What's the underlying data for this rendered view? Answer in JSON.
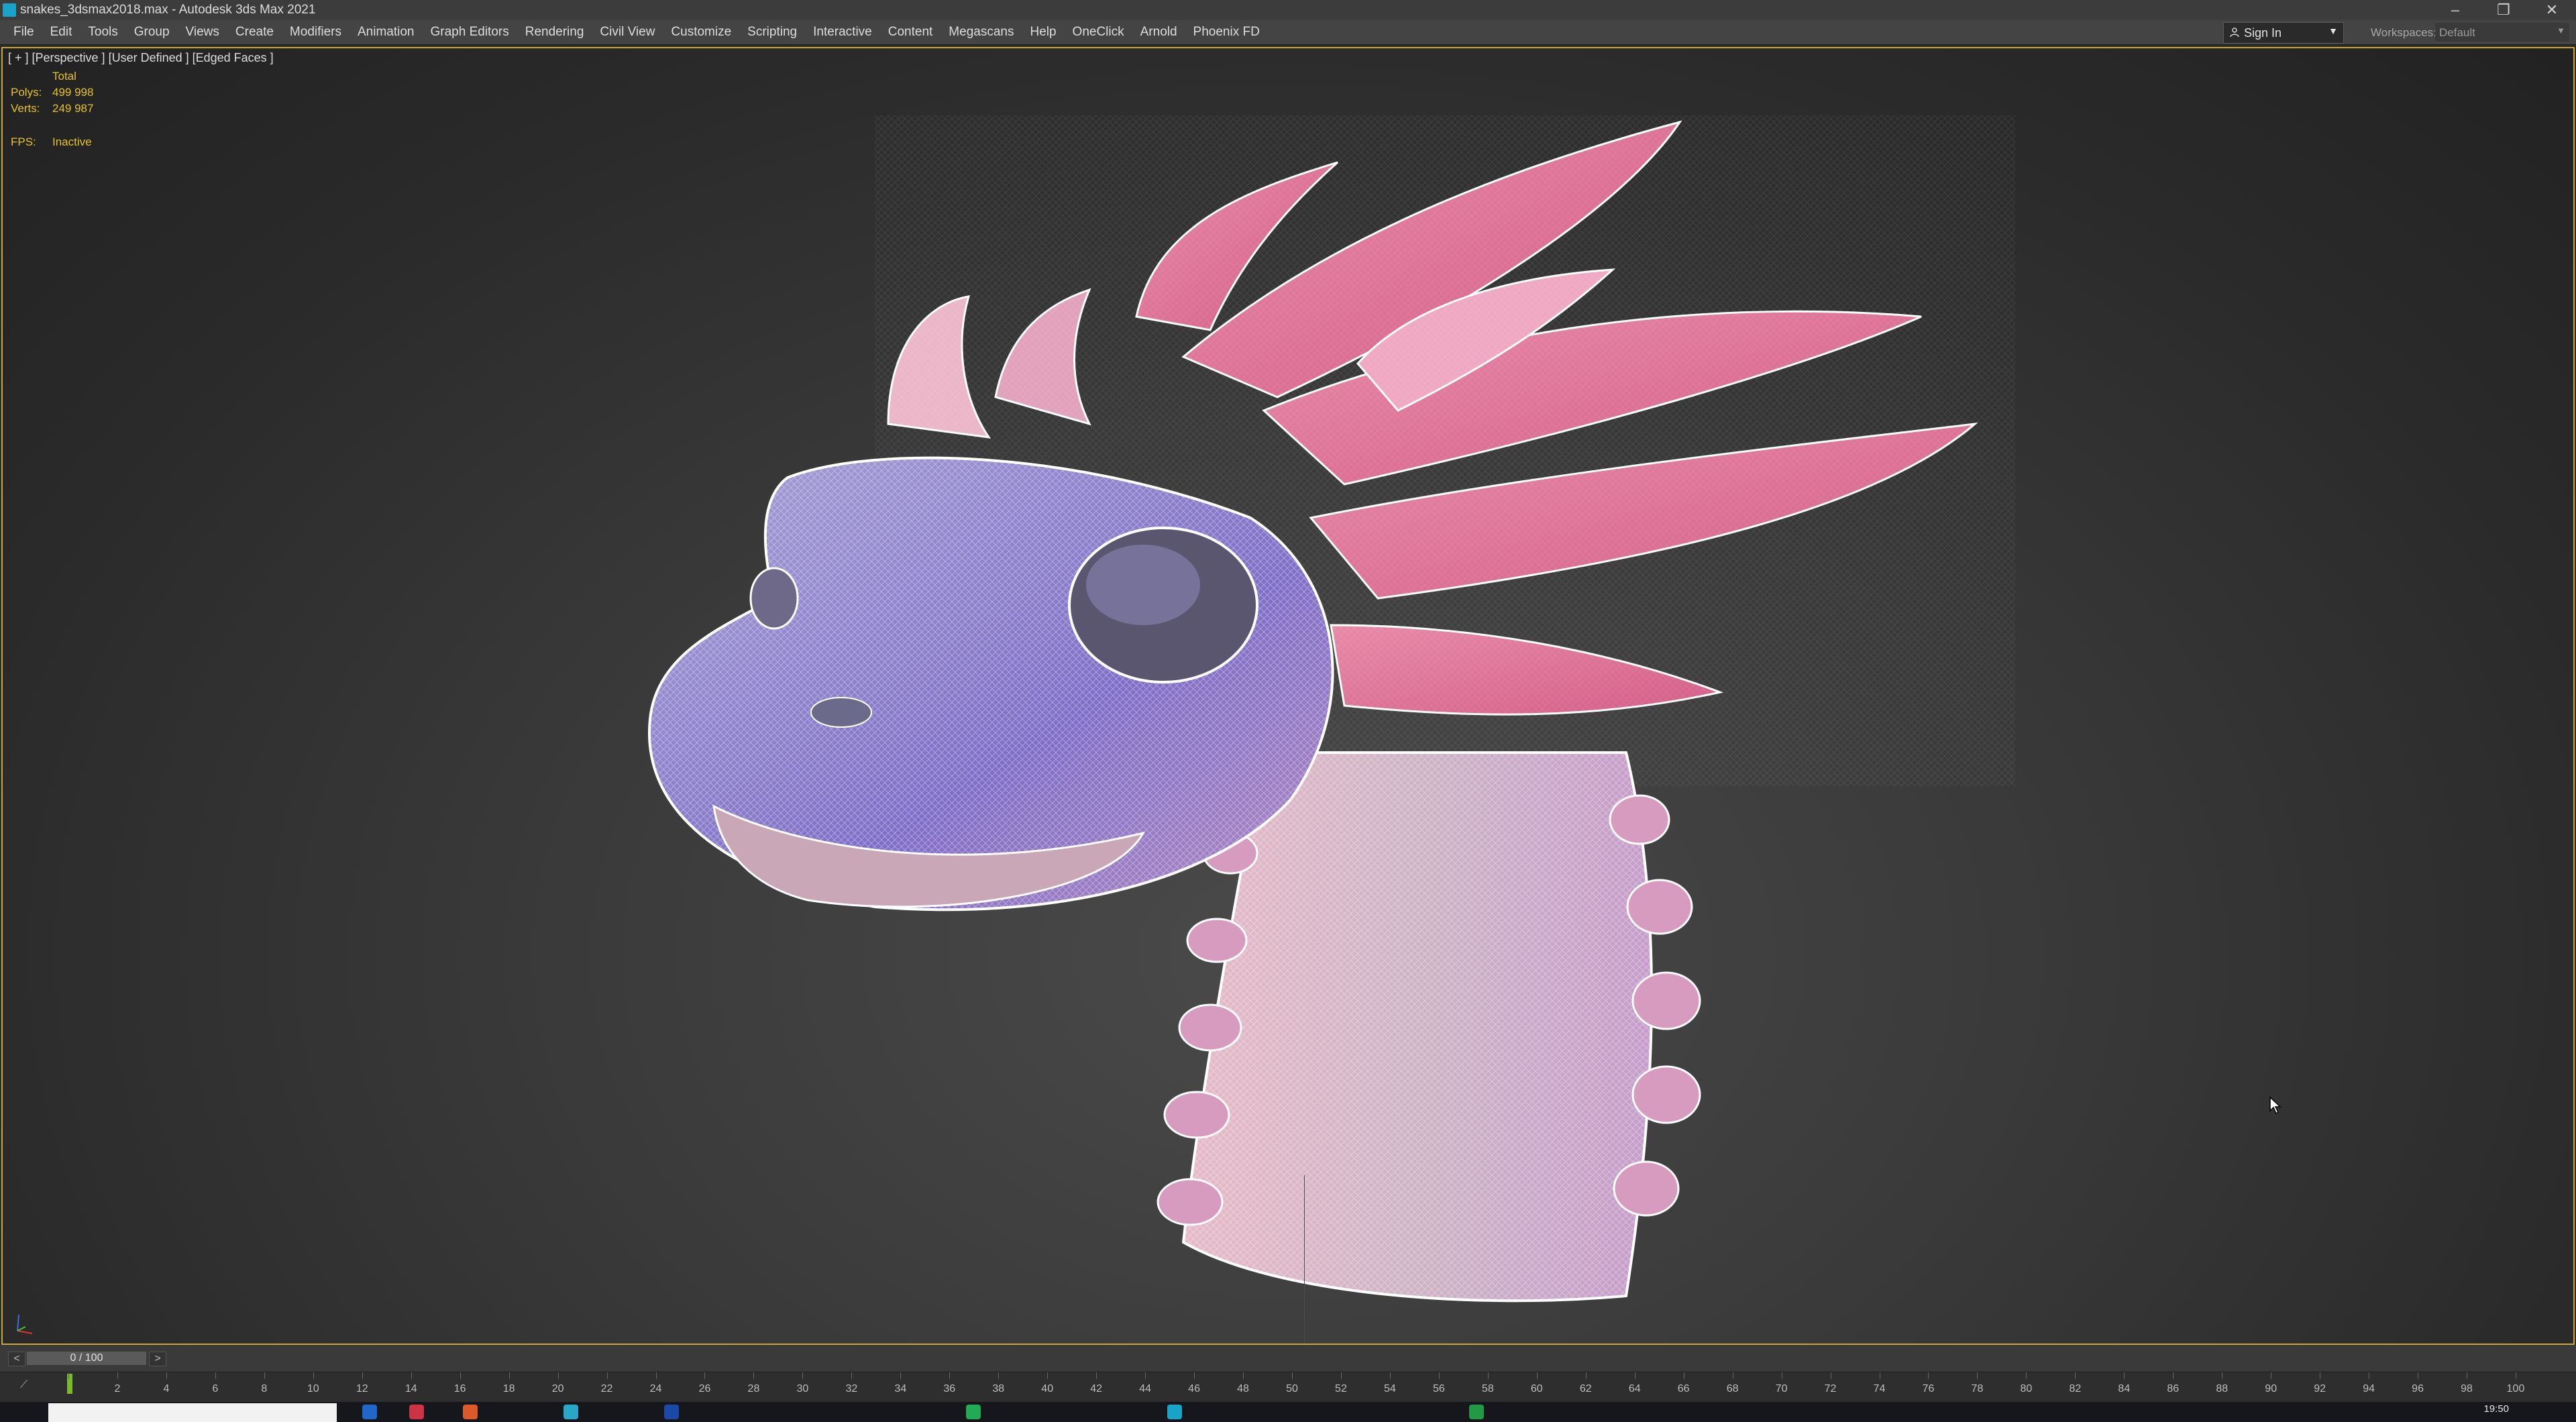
{
  "window": {
    "title": "snakes_3dsmax2018.max - Autodesk 3ds Max 2021",
    "controls": {
      "minimize": "–",
      "restore": "❐",
      "close": "✕"
    }
  },
  "menubar": {
    "items": [
      "File",
      "Edit",
      "Tools",
      "Group",
      "Views",
      "Create",
      "Modifiers",
      "Animation",
      "Graph Editors",
      "Rendering",
      "Civil View",
      "Customize",
      "Scripting",
      "Interactive",
      "Content",
      "Megascans",
      "Help",
      "OneClick",
      "Arnold",
      "Phoenix FD"
    ],
    "sign_in": "Sign In",
    "workspaces_label": "Workspaces:",
    "workspaces_value": "Default"
  },
  "viewport": {
    "label": "[ + ] [Perspective ] [User Defined ] [Edged Faces ]",
    "stats_header": "Total",
    "polys_label": "Polys:",
    "polys_value": "499 998",
    "verts_label": "Verts:",
    "verts_value": "249 987",
    "fps_label": "FPS:",
    "fps_value": "Inactive"
  },
  "timeline": {
    "prev": "<",
    "next": ">",
    "slider_text": "0 / 100",
    "current_frame": 0,
    "total_frames": 100,
    "ticks": [
      "0",
      "2",
      "4",
      "6",
      "8",
      "10",
      "12",
      "14",
      "16",
      "18",
      "20",
      "22",
      "24",
      "26",
      "28",
      "30",
      "32",
      "34",
      "36",
      "38",
      "40",
      "42",
      "44",
      "46",
      "48",
      "50",
      "52",
      "54",
      "56",
      "58",
      "60",
      "62",
      "64",
      "66",
      "68",
      "70",
      "72",
      "74",
      "76",
      "78",
      "80",
      "82",
      "84",
      "86",
      "88",
      "90",
      "92",
      "94",
      "96",
      "98",
      "100"
    ]
  },
  "taskbar": {
    "clock": "19:50"
  },
  "colors": {
    "viewport_border": "#c9a63a",
    "stats_text": "#e7c229",
    "playhead": "#7ab82e"
  },
  "icons": [
    "app-icon",
    "user-icon",
    "dropdown-arrow-icon",
    "axis-gizmo-icon",
    "mouse-cursor-icon",
    "key-icon"
  ]
}
